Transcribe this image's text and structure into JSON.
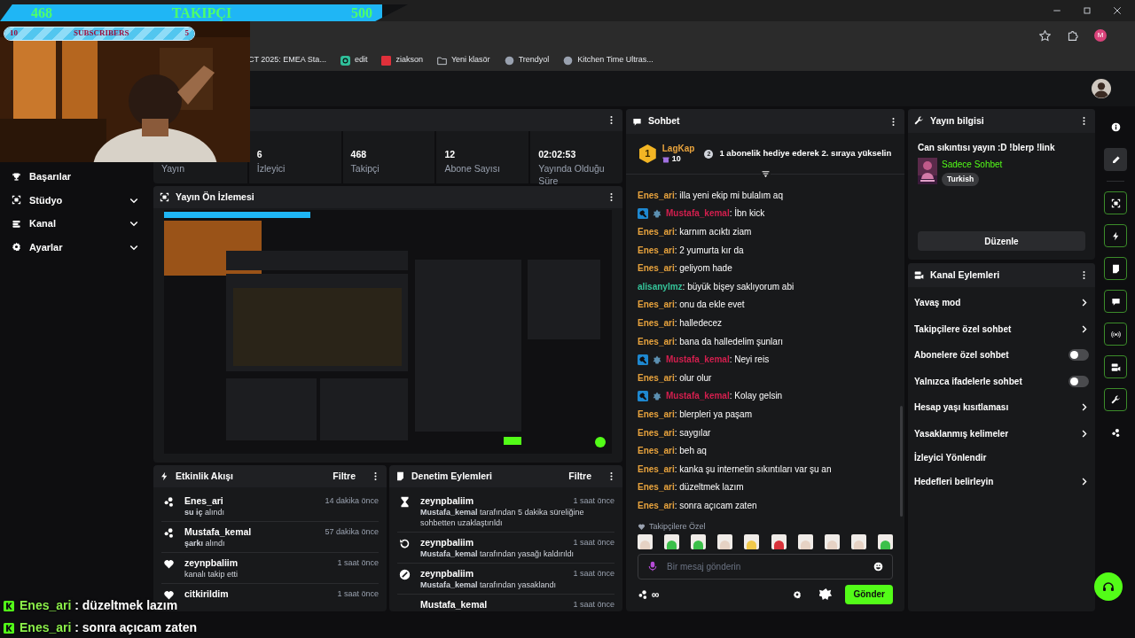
{
  "browser": {
    "bookmarks": [
      {
        "label": "CT 2025: EMEA Sta...",
        "kind": "none"
      },
      {
        "label": "edit",
        "kind": "swirl"
      },
      {
        "label": "ziakson",
        "kind": "tile"
      },
      {
        "label": "Yeni klasör",
        "kind": "folder"
      },
      {
        "label": "Trendyol",
        "kind": "globe"
      },
      {
        "label": "Kitchen Time Ultras...",
        "kind": "globe"
      }
    ],
    "profile_initial": "M"
  },
  "overlay": {
    "follower_goal": {
      "current": "468",
      "label": "TAKIPÇI",
      "target": "500",
      "level": 0.936
    },
    "sub_goal": {
      "current": "10",
      "label": "SUBSCRIBERS",
      "target": "5",
      "level": 1
    },
    "chat_lines": [
      {
        "user": "Enes_ari",
        "text": " : düzeltmek lazım"
      },
      {
        "user": "Enes_ari",
        "text": " : sonra açıcam zaten"
      }
    ]
  },
  "sidebar": {
    "items": [
      {
        "label": "Başarılar",
        "expandable": false
      },
      {
        "label": "Stüdyo",
        "expandable": true
      },
      {
        "label": "Kanal",
        "expandable": true
      },
      {
        "label": "Ayarlar",
        "expandable": true
      }
    ]
  },
  "stats": [
    {
      "label": "Yayın"
    },
    {
      "value": "6",
      "label": "İzleyici"
    },
    {
      "value": "468",
      "label": "Takipçi"
    },
    {
      "value": "12",
      "label": "Abone Sayısı"
    },
    {
      "value": "02:02:53",
      "label": "Yayında Olduğu Süre"
    }
  ],
  "preview": {
    "title": "Yayın Ön İzlemesi"
  },
  "activity": {
    "title": "Etkinlik Akışı",
    "filter": "Filtre",
    "items": [
      {
        "kind": "reward",
        "user": "Enes_ari",
        "detail": "**su iç** alındı",
        "time": "14 dakika önce"
      },
      {
        "kind": "reward",
        "user": "Mustafa_kemal",
        "detail": "**şarkı** alındı",
        "time": "57 dakika önce"
      },
      {
        "kind": "follow",
        "user": "zeynpbaliim",
        "detail": "kanalı takip etti",
        "time": "1 saat önce"
      },
      {
        "kind": "follow",
        "user": "citkirildim",
        "time": "1 saat önce"
      }
    ]
  },
  "moderation": {
    "title": "Denetim Eylemleri",
    "filter": "Filtre",
    "items": [
      {
        "kind": "timeout",
        "user": "zeynpbaliim",
        "detail": "**Mustafa_kemal** tarafından 5 dakika süreliğine sohbetten uzaklaştırıldı",
        "time": "1 saat önce"
      },
      {
        "kind": "unban",
        "user": "zeynpbaliim",
        "detail": "**Mustafa_kemal** tarafından yasağı kaldırıldı",
        "time": "1 saat önce"
      },
      {
        "kind": "ban",
        "user": "zeynpbaliim",
        "detail": "**Mustafa_kemal** tarafından yasaklandı",
        "time": "1 saat önce"
      },
      {
        "user": "Mustafa_kemal",
        "time": "1 saat önce"
      }
    ]
  },
  "chat": {
    "title": "Sohbet",
    "pinned": {
      "rank": "1",
      "user": "LagKap",
      "gifts": "10",
      "next_rank": "2",
      "text": "1 abonelik hediye ederek 2. sıraya yükselin"
    },
    "messages": [
      {
        "user": "Enes_ari",
        "color": "#e8a33d",
        "text": ": illa yeni ekip mi bulalım aq"
      },
      {
        "user": "Mustafa_kemal",
        "color": "#d31f4e",
        "badges": [
          {
            "kind": "moderator"
          },
          {
            "kind": "og"
          }
        ],
        "text": ": İbn kick"
      },
      {
        "user": "Enes_ari",
        "color": "#e8a33d",
        "text": ": karnım acıktı ziam"
      },
      {
        "user": "Enes_ari",
        "color": "#e8a33d",
        "text": ": 2 yumurta kır da"
      },
      {
        "user": "Enes_ari",
        "color": "#e8a33d",
        "text": ": geliyom hade"
      },
      {
        "user": "alisanylmz",
        "color": "#35c49a",
        "text": ": büyük bişey saklıyorum abi"
      },
      {
        "user": "Enes_ari",
        "color": "#e8a33d",
        "text": ": onu da ekle evet"
      },
      {
        "user": "Enes_ari",
        "color": "#e8a33d",
        "text": ": halledecez"
      },
      {
        "user": "Enes_ari",
        "color": "#e8a33d",
        "text": ": bana da halledelim şunları"
      },
      {
        "user": "Mustafa_kemal",
        "color": "#d31f4e",
        "badges": [
          {
            "kind": "moderator"
          },
          {
            "kind": "og"
          }
        ],
        "text": ": Neyi reis"
      },
      {
        "user": "Enes_ari",
        "color": "#e8a33d",
        "text": ": olur olur"
      },
      {
        "user": "Mustafa_kemal",
        "color": "#d31f4e",
        "badges": [
          {
            "kind": "moderator"
          },
          {
            "kind": "og"
          }
        ],
        "text": ": Kolay gelsin"
      },
      {
        "user": "Enes_ari",
        "color": "#e8a33d",
        "text": ": blerpleri ya paşam"
      },
      {
        "user": "Enes_ari",
        "color": "#e8a33d",
        "text": ": saygılar"
      },
      {
        "user": "Enes_ari",
        "color": "#e8a33d",
        "text": ": beh aq"
      },
      {
        "user": "Enes_ari",
        "color": "#e8a33d",
        "text": ": kanka şu internetin sıkıntıları var şu an"
      },
      {
        "user": "Enes_ari",
        "color": "#e8a33d",
        "text": ": düzeltmek lazım"
      },
      {
        "user": "Enes_ari",
        "color": "#e8a33d",
        "text": ": sonra açıcam zaten"
      }
    ],
    "emote_section": "Takipçilere Özel",
    "emotes": [
      {
        "color": "#e6d2c4"
      },
      {
        "color": "#3cc04a"
      },
      {
        "color": "#3cc04a"
      },
      {
        "color": "#e6d2c4"
      },
      {
        "color": "#f0c84a"
      },
      {
        "color": "#d8323a"
      },
      {
        "color": "#e6d2c4"
      },
      {
        "color": "#e6d2c4"
      },
      {
        "color": "#e6d2c4"
      },
      {
        "color": "#3cc04a"
      }
    ],
    "input": {
      "placeholder": "Bir mesaj gönderin"
    },
    "points": "∞",
    "send": "Gönder"
  },
  "stream_info": {
    "title": "Yayın bilgisi",
    "stream_title": "Can sıkıntısı yayın :D !blerp !link",
    "category": "Sadece Sohbet",
    "tag": "Turkish",
    "edit": "Düzenle"
  },
  "channel_actions": {
    "title": "Kanal Eylemleri",
    "items": [
      {
        "label": "Yavaş mod",
        "kind": "link"
      },
      {
        "label": "Takipçilere özel sohbet",
        "kind": "link"
      },
      {
        "label": "Abonelere özel sohbet",
        "kind": "toggle",
        "on": false
      },
      {
        "label": "Yalnızca ifadelerle sohbet",
        "kind": "toggle",
        "on": false
      },
      {
        "label": "Hesap yaşı kısıtlaması",
        "kind": "link"
      },
      {
        "label": "Yasaklanmış kelimeler",
        "kind": "link"
      },
      {
        "label": "İzleyici Yönlendir",
        "kind": "action"
      },
      {
        "label": "Hedefleri belirleyin",
        "kind": "link"
      }
    ]
  },
  "rail": [
    {
      "selected": false,
      "pinned": false
    },
    {
      "selected": true,
      "pinned": false
    },
    {
      "selected": false,
      "pinned": true
    },
    {
      "selected": false,
      "pinned": true
    },
    {
      "selected": false,
      "pinned": true
    },
    {
      "selected": false,
      "pinned": true
    },
    {
      "selected": false,
      "pinned": true
    },
    {
      "selected": false,
      "pinned": true
    },
    {
      "selected": false,
      "pinned": true
    },
    {
      "selected": false,
      "pinned": false
    }
  ]
}
